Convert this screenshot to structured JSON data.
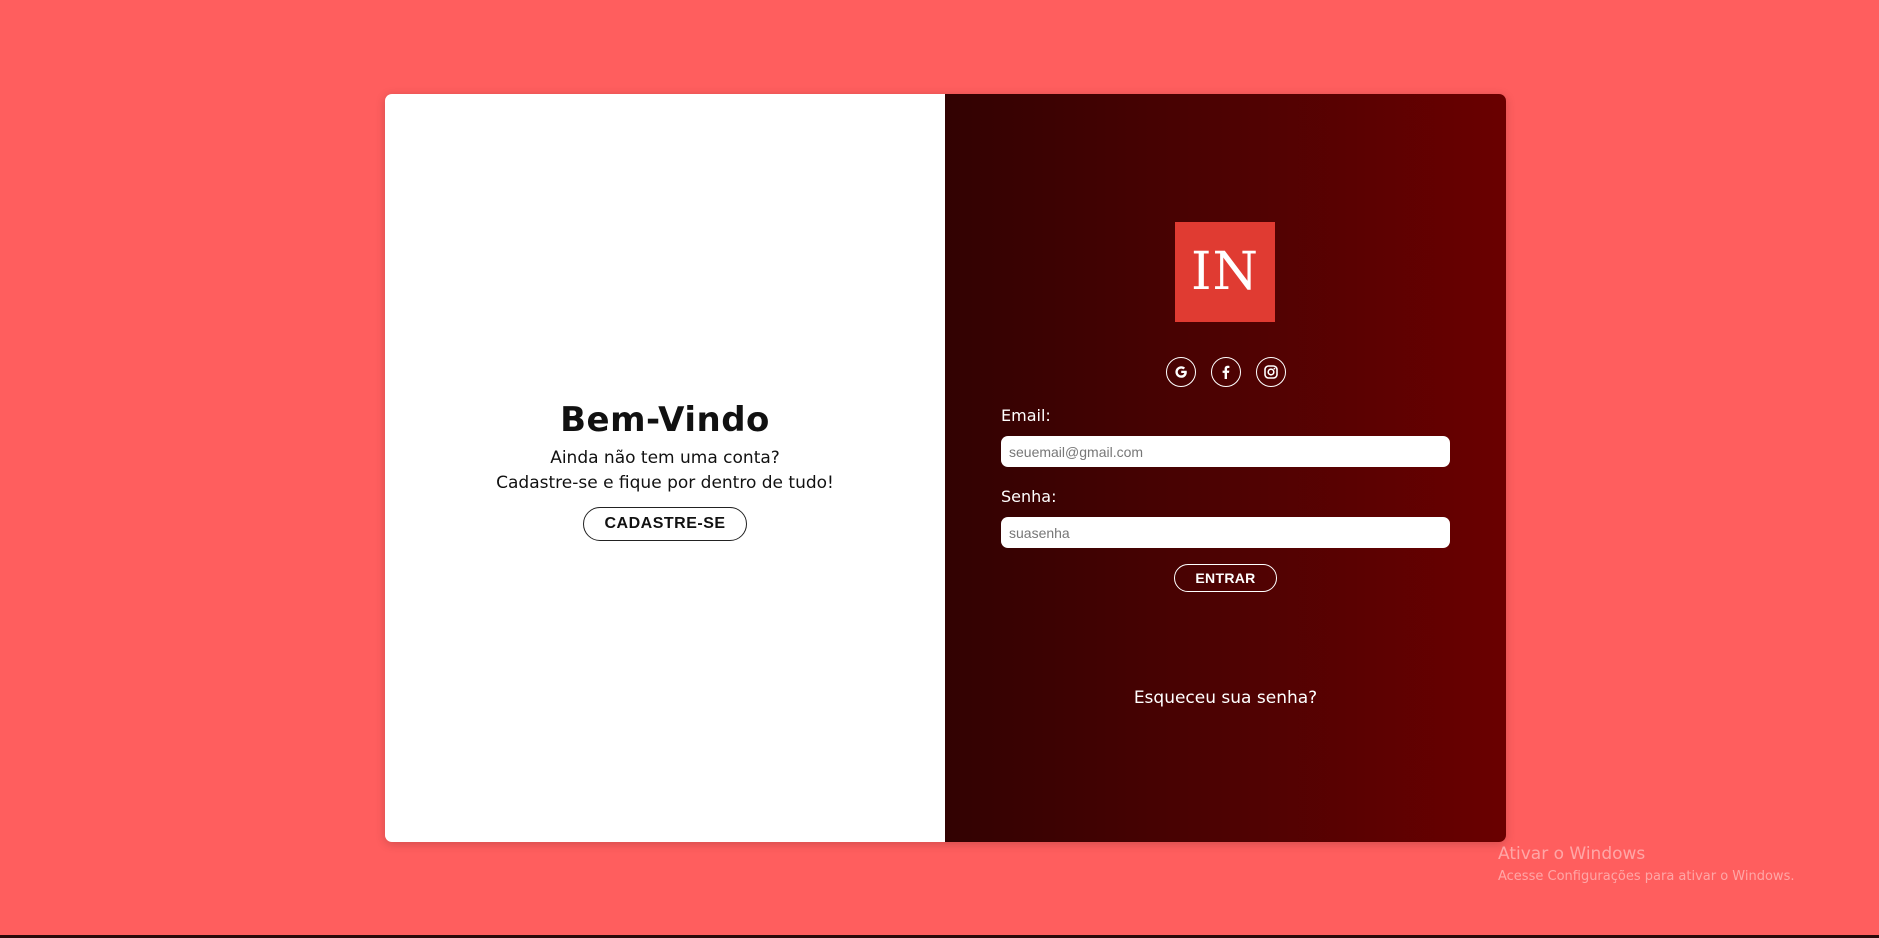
{
  "left_panel": {
    "title": "Bem-Vindo",
    "line1": "Ainda não tem uma conta?",
    "line2": "Cadastre-se e fique por dentro de tudo!",
    "signup_label": "CADASTRE-SE"
  },
  "right_panel": {
    "logo_text": "IN",
    "socials": [
      {
        "name": "google-icon",
        "glyph": "G"
      },
      {
        "name": "facebook-icon",
        "glyph": "f"
      },
      {
        "name": "instagram-icon",
        "glyph": "instagram"
      }
    ],
    "email_label": "Email:",
    "email_placeholder": "seuemail@gmail.com",
    "password_label": "Senha:",
    "password_placeholder": "suasenha",
    "enter_label": "ENTRAR",
    "forgot_label": "Esqueceu sua senha?"
  },
  "watermark": {
    "title": "Ativar o Windows",
    "subtitle": "Acesse Configurações para ativar o Windows."
  },
  "colors": {
    "background": "#ff5e5e",
    "logo_bg": "#e03b32",
    "panel_dark": "#320202",
    "panel_red": "#6a0000"
  }
}
